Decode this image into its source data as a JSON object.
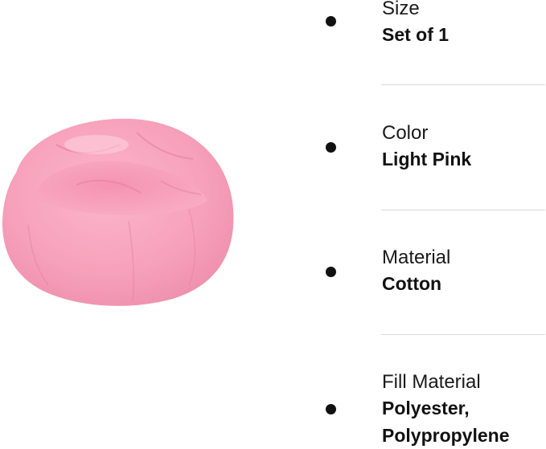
{
  "specs": [
    {
      "label": "Size",
      "value": "Set of 1"
    },
    {
      "label": "Color",
      "value": "Light Pink"
    },
    {
      "label": "Material",
      "value": "Cotton"
    },
    {
      "label": "Fill Material",
      "value_line1": "Polyester,",
      "value_line2": "Polypropylene"
    }
  ],
  "colors": {
    "product": "#f9a8c0",
    "divider": "#d9d9d9",
    "bullet": "#111111"
  }
}
